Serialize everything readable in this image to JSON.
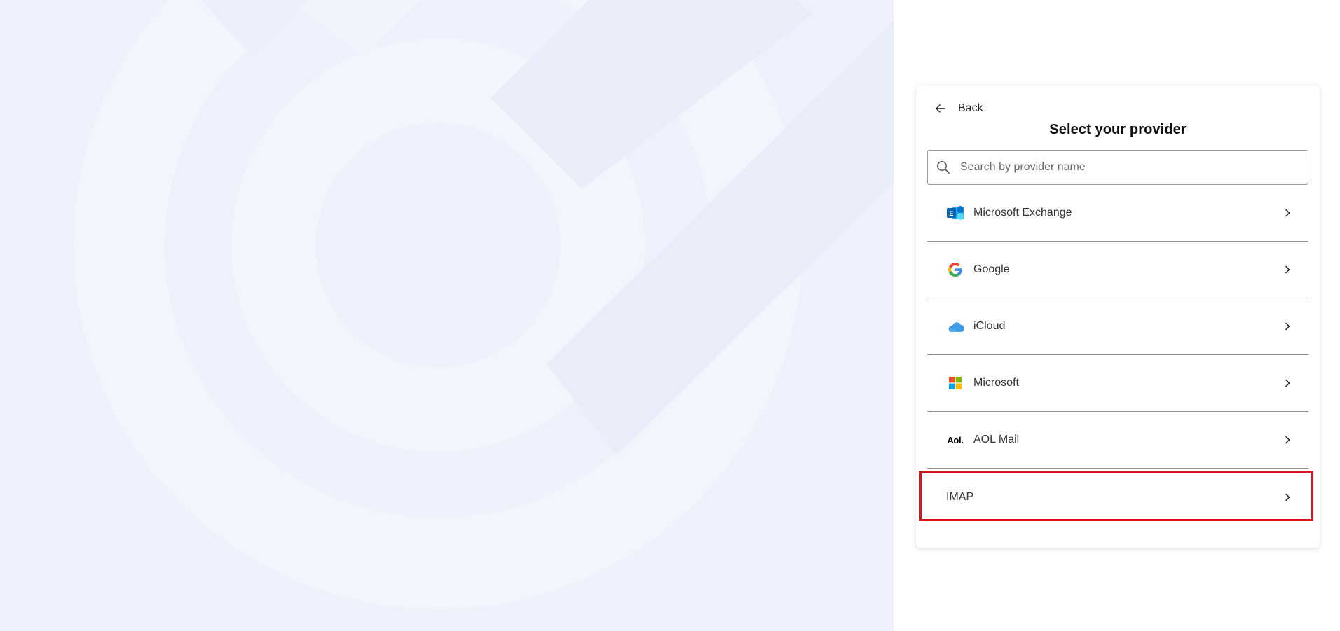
{
  "back": {
    "label": "Back"
  },
  "title": "Select your provider",
  "search": {
    "placeholder": "Search by provider name",
    "value": ""
  },
  "providers": [
    {
      "label": "Microsoft Exchange",
      "icon": "microsoft-exchange-icon"
    },
    {
      "label": "Google",
      "icon": "google-icon"
    },
    {
      "label": "iCloud",
      "icon": "icloud-icon"
    },
    {
      "label": "Microsoft",
      "icon": "microsoft-icon"
    },
    {
      "label": "AOL Mail",
      "icon": "aol-icon",
      "logo_text": "Aol."
    },
    {
      "label": "IMAP",
      "icon": null
    }
  ],
  "colors": {
    "backdrop": "#eef1fb",
    "highlight": "#d9161c",
    "divider": "#8f8f8f"
  }
}
